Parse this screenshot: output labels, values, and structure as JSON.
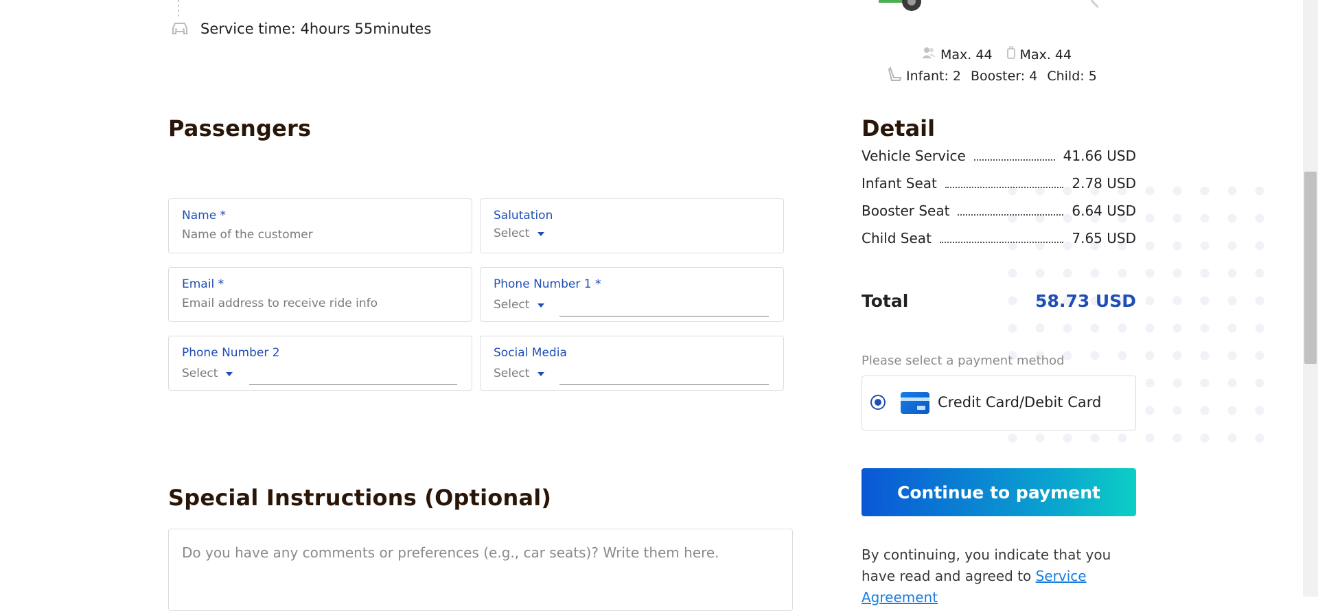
{
  "service": {
    "time_text": "Service time: 4hours 55minutes"
  },
  "vehicle": {
    "max_passengers": "Max. 44",
    "max_luggage": "Max. 44",
    "infant": "Infant: 2",
    "booster": "Booster: 4",
    "child": "Child: 5"
  },
  "passengers": {
    "title": "Passengers",
    "fields": {
      "name": {
        "label": "Name *",
        "placeholder": "Name of the customer"
      },
      "salutation": {
        "label": "Salutation",
        "value": "Select"
      },
      "email": {
        "label": "Email *",
        "placeholder": "Email address to receive ride info"
      },
      "phone1": {
        "label": "Phone Number 1 *",
        "value": "Select"
      },
      "phone2": {
        "label": "Phone Number 2",
        "value": "Select"
      },
      "social": {
        "label": "Social Media",
        "value": "Select"
      }
    }
  },
  "instructions": {
    "title": "Special Instructions (Optional)",
    "placeholder": "Do you have any comments or preferences (e.g., car seats)? Write them here."
  },
  "detail": {
    "title": "Detail",
    "rows": [
      {
        "label": "Vehicle Service",
        "amount": "41.66 USD"
      },
      {
        "label": "Infant Seat",
        "amount": "2.78 USD"
      },
      {
        "label": "Booster Seat",
        "amount": "6.64 USD"
      },
      {
        "label": "Child Seat",
        "amount": "7.65 USD"
      }
    ],
    "total_label": "Total",
    "total_amount": "58.73 USD"
  },
  "payment": {
    "hint": "Please select a payment method",
    "method": "Credit Card/Debit Card",
    "continue_label": "Continue to payment",
    "agree_text": "By continuing, you indicate that you have read and agreed to ",
    "agree_link": "Service Agreement"
  },
  "colors": {
    "accent": "#1f4eb6",
    "heading": "#2a1608",
    "button_start": "#0a57d6",
    "button_end": "#0ccfc6"
  }
}
